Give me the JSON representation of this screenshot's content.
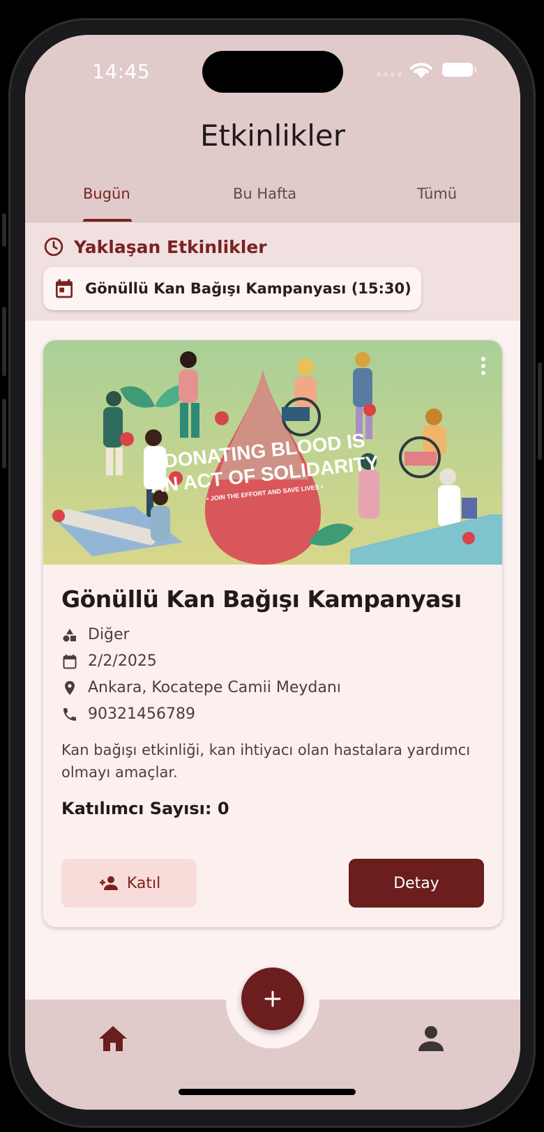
{
  "status_bar": {
    "time": "14:45"
  },
  "header": {
    "title": "Etkinlikler"
  },
  "tabs": [
    {
      "label": "Bugün",
      "active": true
    },
    {
      "label": "Bu Hafta",
      "active": false
    },
    {
      "label": "Tümü",
      "active": false
    }
  ],
  "upcoming": {
    "title": "Yaklaşan Etkinlikler",
    "icon": "clock-icon",
    "chips": [
      {
        "label": "Gönüllü Kan Bağışı Kampanyası (15:30)",
        "icon": "calendar-icon"
      }
    ]
  },
  "event": {
    "image": {
      "headline_1": "DONATING BLOOD IS",
      "headline_2": "AN ACT OF SOLIDARITY",
      "tagline": "• JOIN THE EFFORT AND SAVE LIVES •"
    },
    "title": "Gönüllü Kan Bağışı Kampanyası",
    "category": "Diğer",
    "date": "2/2/2025",
    "location": "Ankara, Kocatepe Camii Meydanı",
    "phone": "90321456789",
    "description": "Kan bağışı etkinliği, kan ihtiyacı olan hastalara yardımcı olmayı amaçlar.",
    "participants": "Katılımcı Sayısı: 0",
    "join_label": "Katıl",
    "detail_label": "Detay"
  },
  "bottom_nav": {
    "fab_icon": "plus-icon",
    "items": [
      "home-icon",
      "profile-icon"
    ]
  },
  "colors": {
    "primary": "#6c1d1d",
    "accent_text": "#7a2222",
    "bar_bg": "#e0cbca",
    "page_bg": "#fcf2f1"
  }
}
